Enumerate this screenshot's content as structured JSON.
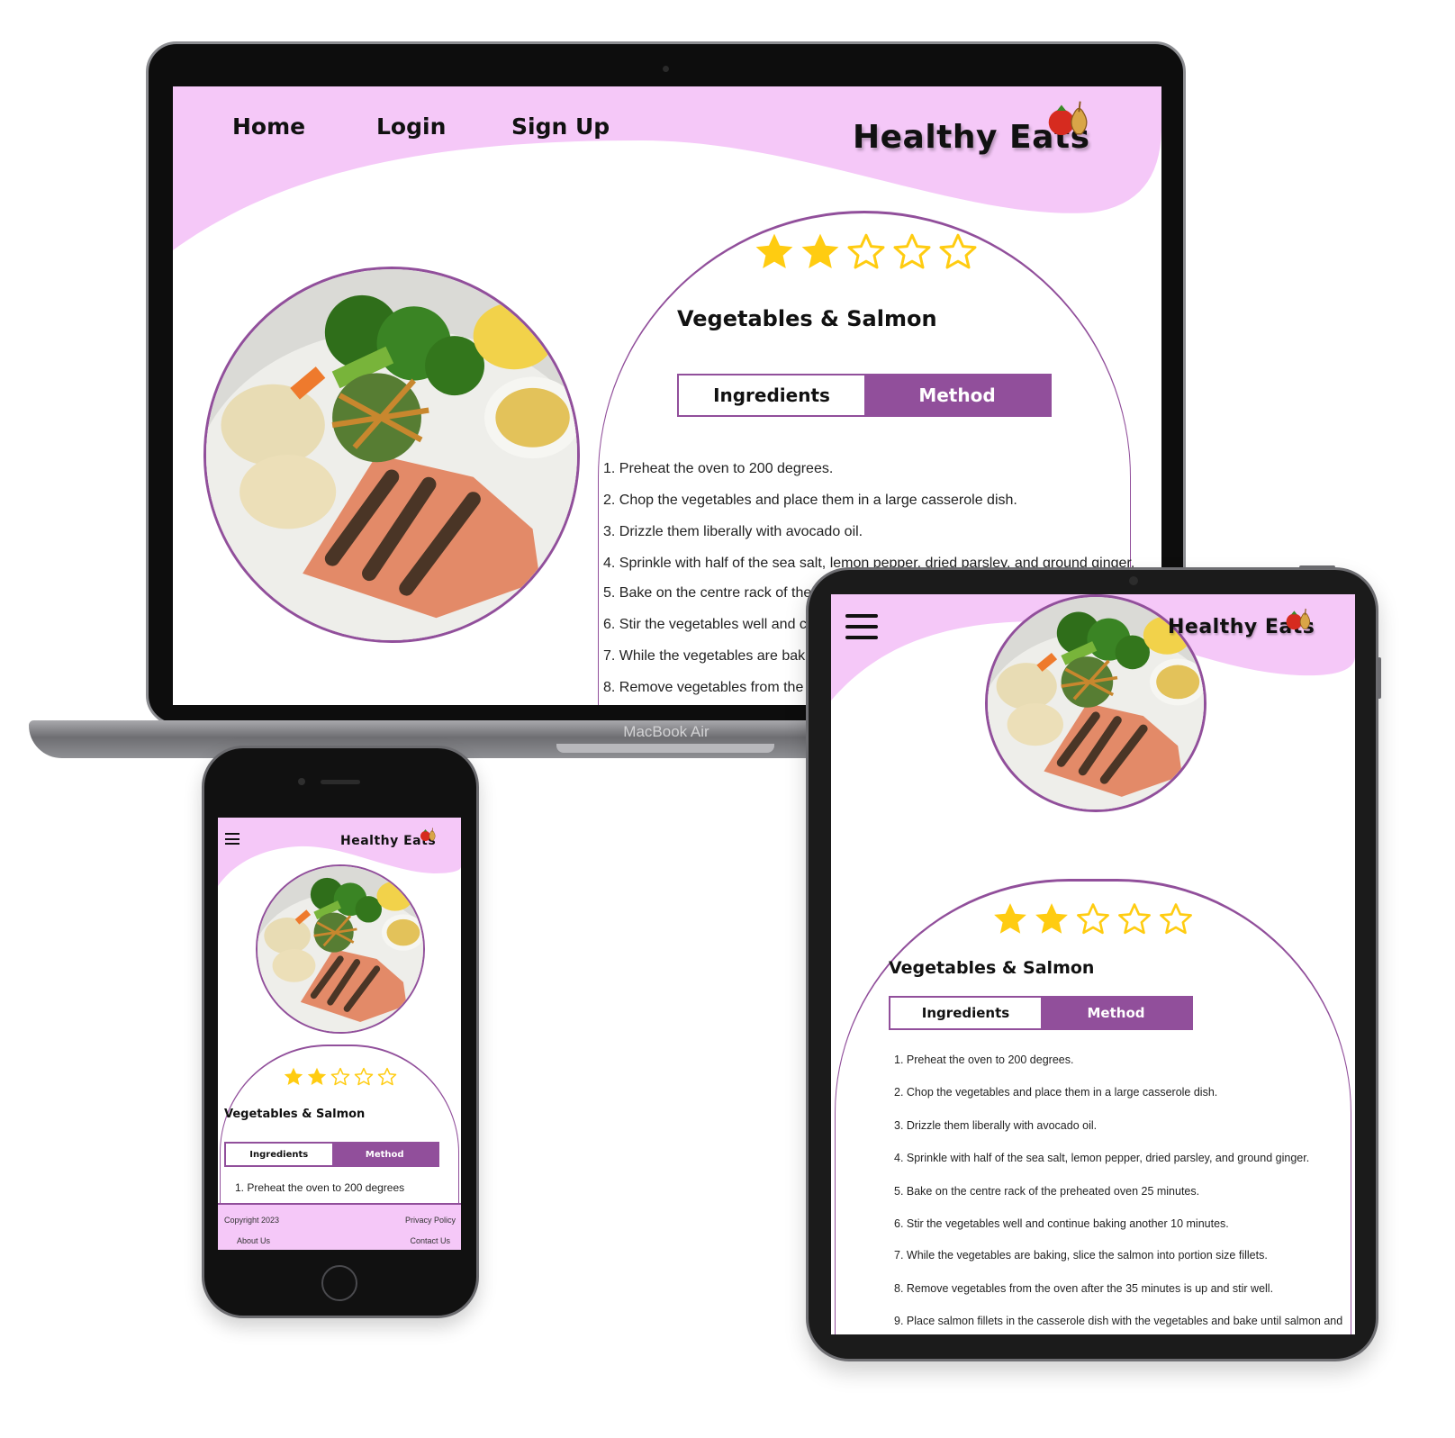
{
  "brand": {
    "name": "Healthy Eats",
    "accent": "#914f9b",
    "header_bg": "#f5c8f8",
    "star_color": "#ffcc11"
  },
  "laptop": {
    "nav": {
      "home": "Home",
      "login": "Login",
      "signup": "Sign Up"
    },
    "device_label": "MacBook Air"
  },
  "recipe": {
    "title": "Vegetables & Salmon",
    "rating": 2,
    "rating_max": 5,
    "tabs": {
      "ingredients": "Ingredients",
      "method": "Method"
    },
    "active_tab": "Method",
    "steps_desktop": [
      "1. Preheat the oven to 200 degrees.",
      "2. Chop the vegetables and place them in a large casserole dish.",
      "3. Drizzle them liberally with avocado oil.",
      "4. Sprinkle with half of the sea salt, lemon pepper, dried parsley, and ground ginger.",
      "5. Bake on the centre rack of the p",
      "6. Stir the vegetables well and con",
      "7. While the vegetables are baking",
      "8. Remove vegetables from the ov"
    ],
    "steps_tablet": [
      "1. Preheat the oven to 200 degrees.",
      "2. Chop the vegetables and place them in a large casserole dish.",
      "3. Drizzle them liberally with avocado oil.",
      "4. Sprinkle with half of the sea salt, lemon pepper, dried parsley, and ground ginger.",
      "5. Bake on the centre rack of the preheated oven 25 minutes.",
      "6. Stir the vegetables well and continue baking another 10 minutes.",
      "7. While the vegetables are baking, slice the salmon into portion size fillets.",
      "8. Remove vegetables from the oven after the 35 minutes is up and stir well.",
      "9. Place salmon fillets in the casserole dish with the vegetables and bake until salmon and"
    ],
    "steps_phone": [
      "1. Preheat the oven to 200 degrees"
    ]
  },
  "phone_footer": {
    "copyright": "Copyright 2023",
    "privacy": "Privacy Policy",
    "about": "About Us",
    "contact": "Contact Us"
  },
  "icons": [
    "hamburger-menu-icon",
    "star-filled-icon",
    "star-outline-icon",
    "vegetable-logo-icon",
    "camera-icon",
    "home-button-icon"
  ]
}
